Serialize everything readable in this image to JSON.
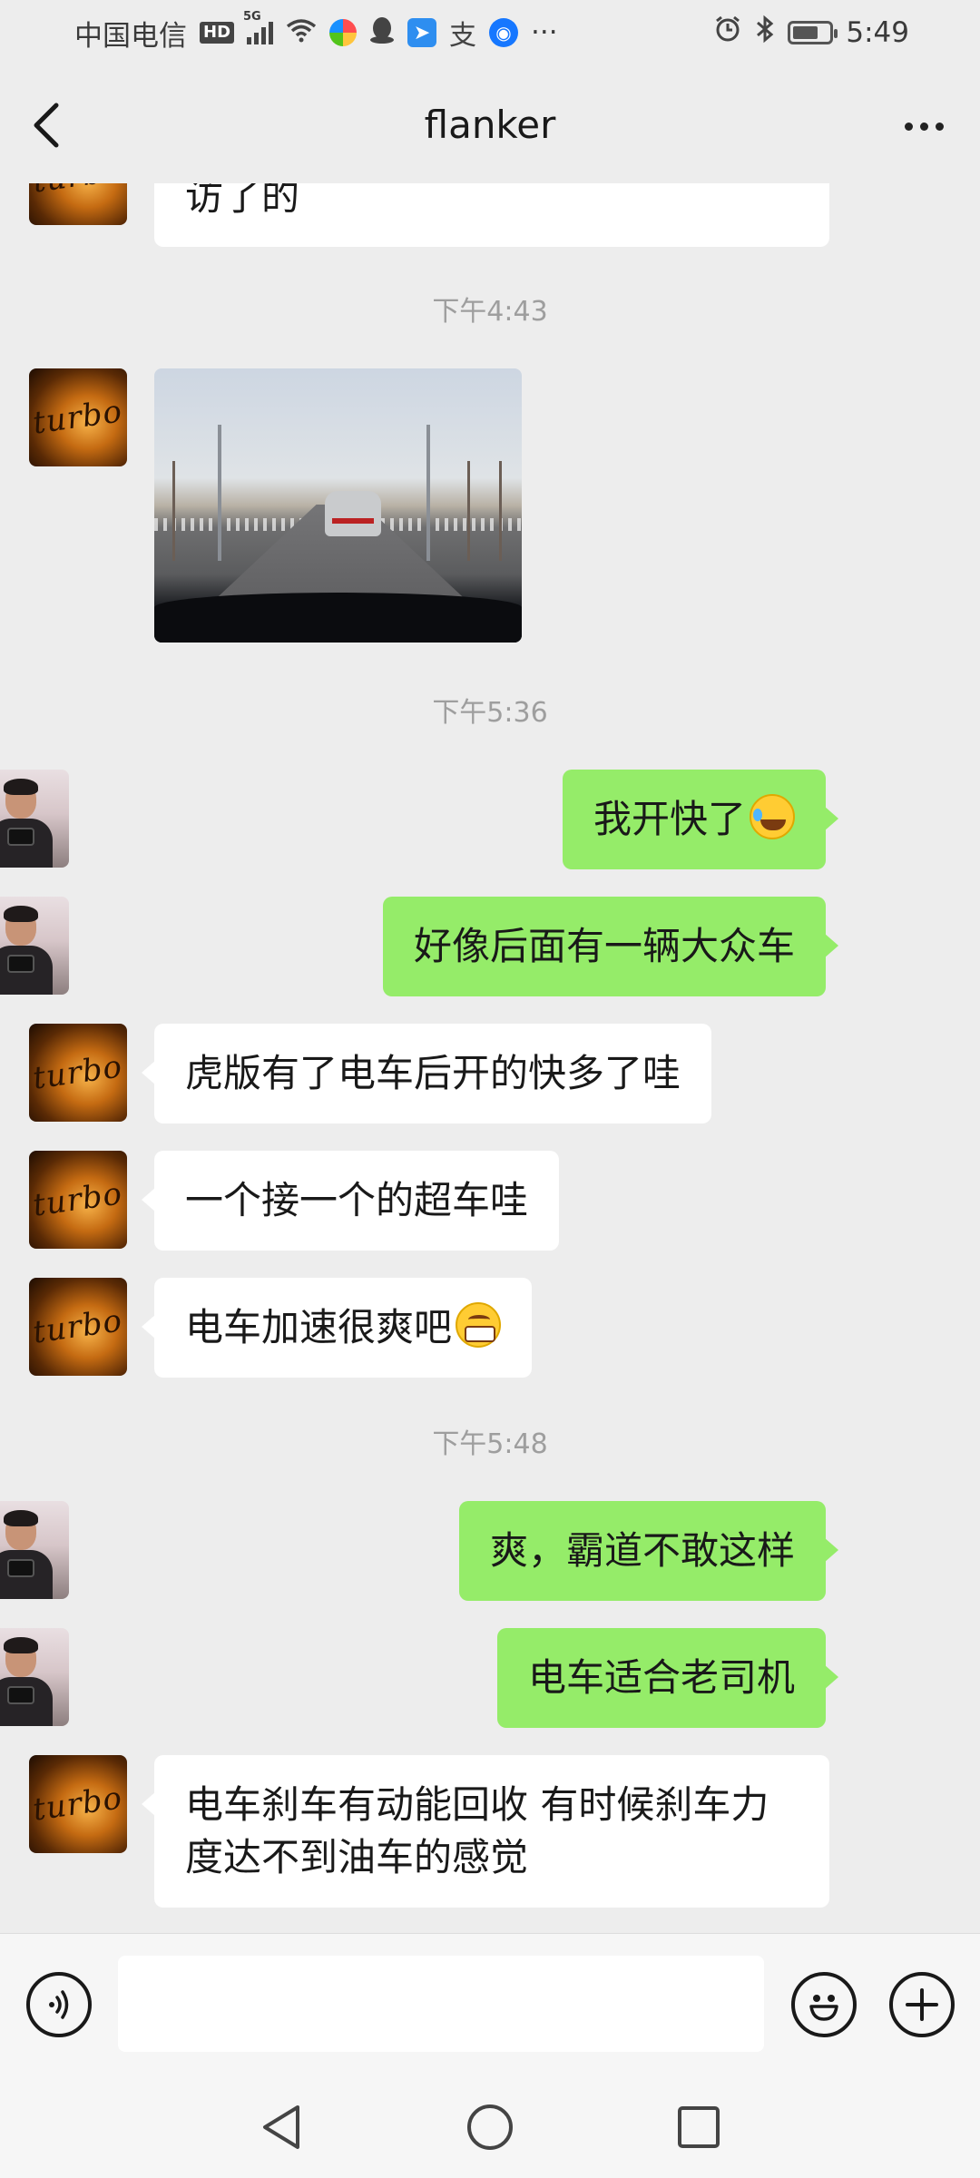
{
  "status_bar": {
    "carrier": "中国电信",
    "hd": "HD",
    "network": "5G",
    "more": "···",
    "time": "5:49",
    "battery_level": 0.7
  },
  "nav": {
    "title": "flanker"
  },
  "messages": [
    {
      "type": "text",
      "side": "in",
      "text": "访了的"
    },
    {
      "type": "timestamp",
      "text": "下午4:43"
    },
    {
      "type": "image",
      "side": "in"
    },
    {
      "type": "timestamp",
      "text": "下午5:36"
    },
    {
      "type": "text",
      "side": "out",
      "text": "我开快了",
      "emoji": "laughing-crying-emoji"
    },
    {
      "type": "text",
      "side": "out",
      "text": "好像后面有一辆大众车"
    },
    {
      "type": "text",
      "side": "in",
      "text": "虎版有了电车后开的快多了哇"
    },
    {
      "type": "text",
      "side": "in",
      "text": "一个接一个的超车哇"
    },
    {
      "type": "text",
      "side": "in",
      "text": "电车加速很爽吧",
      "emoji": "grinning-emoji"
    },
    {
      "type": "timestamp",
      "text": "下午5:48"
    },
    {
      "type": "text",
      "side": "out",
      "text": "爽，霸道不敢这样"
    },
    {
      "type": "text",
      "side": "out",
      "text": "电车适合老司机"
    },
    {
      "type": "text",
      "side": "in",
      "text": "电车刹车有动能回收 有时候刹车力度达不到油车的感觉"
    }
  ],
  "avatars": {
    "contact": {
      "label": "turbo",
      "icon": "turbo-badge-avatar"
    },
    "self": {
      "icon": "photographer-avatar"
    }
  },
  "input": {
    "placeholder": "",
    "value": ""
  },
  "colors": {
    "background": "#ededed",
    "bubble_out": "#95ec69",
    "bubble_in": "#ffffff",
    "timestamp": "#9e9e9e"
  }
}
